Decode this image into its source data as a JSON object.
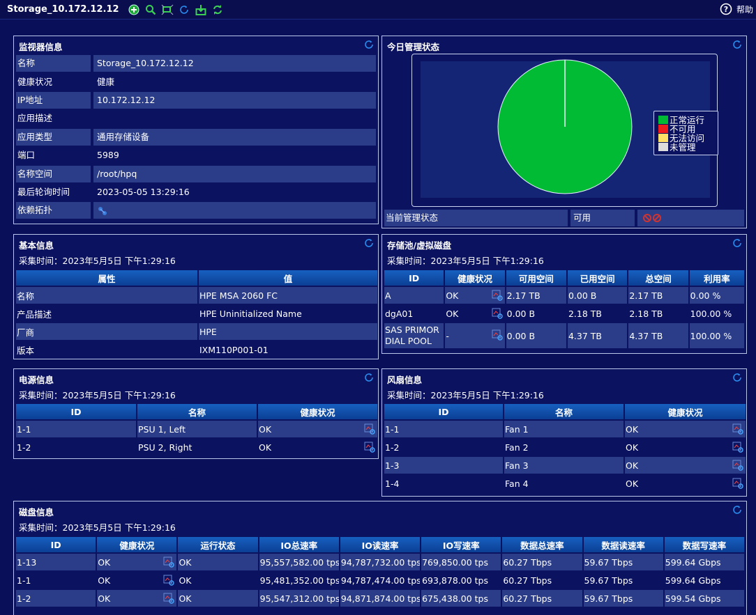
{
  "toolbar": {
    "title": "Storage_10.172.12.12",
    "help_label": "帮助"
  },
  "monitor": {
    "title": "监视器信息",
    "rows": [
      {
        "k": "名称",
        "v": "Storage_10.172.12.12"
      },
      {
        "k": "健康状况",
        "v": "健康"
      },
      {
        "k": "IP地址",
        "v": "10.172.12.12"
      },
      {
        "k": "应用描述",
        "v": ""
      },
      {
        "k": "应用类型",
        "v": "通用存储设备"
      },
      {
        "k": "端口",
        "v": "5989"
      },
      {
        "k": "名称空间",
        "v": "/root/hpq"
      },
      {
        "k": "最后轮询时间",
        "v": "2023-05-05 13:29:16"
      },
      {
        "k": "依赖拓扑",
        "v": ""
      }
    ]
  },
  "today": {
    "title": "今日管理状态",
    "status_label": "当前管理状态",
    "status_value": "可用",
    "chart_data": {
      "type": "pie",
      "categories": [
        "正常运行",
        "不可用",
        "无法访问",
        "未管理"
      ],
      "values": [
        100,
        0,
        0,
        0
      ],
      "colors": [
        "#00bb33",
        "#ee1c1c",
        "#ffe066",
        "#dcdcdc"
      ],
      "legend": "right"
    }
  },
  "basic": {
    "title": "基本信息",
    "timestamp": "采集时间：2023年5月5日 下午1:29:16",
    "headers": [
      "属性",
      "值"
    ],
    "rows": [
      [
        "名称",
        "HPE MSA 2060 FC"
      ],
      [
        "产品描述",
        "HPE Uninitialized Name"
      ],
      [
        "厂商",
        "HPE"
      ],
      [
        "版本",
        "IXM110P001-01"
      ]
    ]
  },
  "pool": {
    "title": "存储池/虚拟磁盘",
    "timestamp": "采集时间：2023年5月5日 下午1:29:16",
    "headers": [
      "ID",
      "健康状况",
      "可用空间",
      "已用空间",
      "总空间",
      "利用率"
    ],
    "rows": [
      [
        "A",
        "OK",
        "2.17 TB",
        "0.00 B",
        "2.17 TB",
        "0.00 %"
      ],
      [
        "dgA01",
        "OK",
        "0.00 B",
        "2.18 TB",
        "2.18 TB",
        "100.00 %"
      ],
      [
        "SAS PRIMOR DIAL POOL",
        "-",
        "0.00 B",
        "4.37 TB",
        "4.37 TB",
        "100.00 %"
      ]
    ]
  },
  "power": {
    "title": "电源信息",
    "timestamp": "采集时间：2023年5月5日 下午1:29:16",
    "headers": [
      "ID",
      "名称",
      "健康状况"
    ],
    "rows": [
      [
        "1-1",
        "PSU 1, Left",
        "OK"
      ],
      [
        "1-2",
        "PSU 2, Right",
        "OK"
      ]
    ]
  },
  "fan": {
    "title": "风扇信息",
    "timestamp": "采集时间：2023年5月5日 下午1:29:16",
    "headers": [
      "ID",
      "名称",
      "健康状况"
    ],
    "rows": [
      [
        "1-1",
        "Fan 1",
        "OK"
      ],
      [
        "1-2",
        "Fan 2",
        "OK"
      ],
      [
        "1-3",
        "Fan 3",
        "OK"
      ],
      [
        "1-4",
        "Fan 4",
        "OK"
      ]
    ]
  },
  "disk": {
    "title": "磁盘信息",
    "timestamp": "采集时间：2023年5月5日 下午1:29:16",
    "headers": [
      "ID",
      "健康状况",
      "运行状态",
      "IO总速率",
      "IO读速率",
      "IO写速率",
      "数据总速率",
      "数据读速率",
      "数据写速率"
    ],
    "rows": [
      [
        "1-13",
        "OK",
        "OK",
        "95,557,582.00 tps",
        "94,787,732.00 tps",
        "769,850.00 tps",
        "60.27 Tbps",
        "59.67 Tbps",
        "599.64 Gbps"
      ],
      [
        "1-1",
        "OK",
        "OK",
        "95,481,352.00 tps",
        "94,787,474.00 tps",
        "693,878.00 tps",
        "60.27 Tbps",
        "59.67 Tbps",
        "599.64 Gbps"
      ],
      [
        "1-2",
        "OK",
        "OK",
        "95,547,312.00 tps",
        "94,871,874.00 tps",
        "675,438.00 tps",
        "60.27 Tbps",
        "59.67 Tbps",
        "599.54 Gbps"
      ]
    ]
  }
}
